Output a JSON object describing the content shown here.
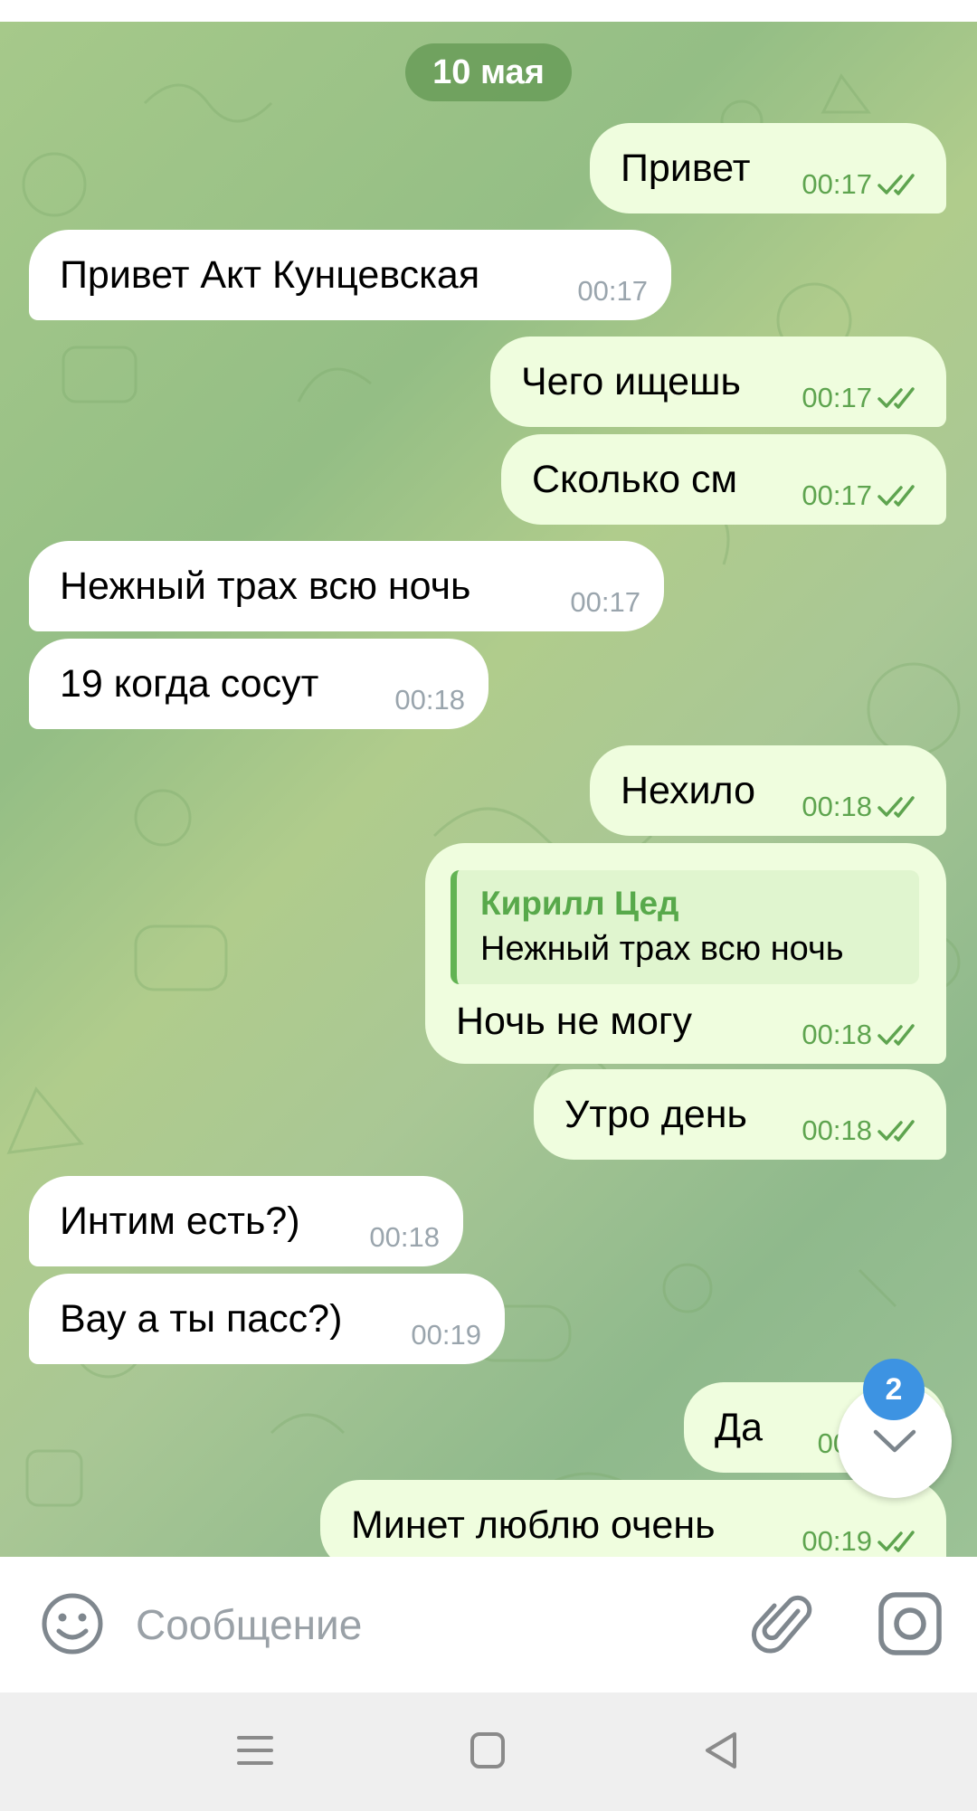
{
  "date_pill": "10 мая",
  "messages": [
    {
      "dir": "out",
      "text": "Привет",
      "time": "00:17",
      "read": true
    },
    {
      "dir": "in",
      "text": "Привет Акт Кунцевская",
      "time": "00:17"
    },
    {
      "dir": "out",
      "text": "Чего ищешь",
      "time": "00:17",
      "read": true
    },
    {
      "dir": "out",
      "text": "Сколько см",
      "time": "00:17",
      "read": true
    },
    {
      "dir": "in",
      "text": "Нежный трах всю ночь",
      "time": "00:17"
    },
    {
      "dir": "in",
      "text": "19 когда сосут",
      "time": "00:18"
    },
    {
      "dir": "out",
      "text": "Нехило",
      "time": "00:18",
      "read": true
    },
    {
      "dir": "out",
      "text": "Ночь не могу",
      "time": "00:18",
      "read": true,
      "reply": {
        "name": "Кирилл Цед",
        "text": "Нежный трах всю ночь"
      }
    },
    {
      "dir": "out",
      "text": "Утро день",
      "time": "00:18",
      "read": true
    },
    {
      "dir": "in",
      "text": "Интим есть?)",
      "time": "00:18"
    },
    {
      "dir": "in",
      "text": "Вау а ты пасс?)",
      "time": "00:19"
    },
    {
      "dir": "out",
      "text": "Да",
      "time": "00:1",
      "read": true
    },
    {
      "dir": "out",
      "text": "Минет люблю очень",
      "time": "00:19",
      "read": true
    }
  ],
  "unread_badge": "2",
  "composer": {
    "placeholder": "Сообщение"
  },
  "icons": {
    "emoji": "emoji-icon",
    "attach": "paperclip-icon",
    "camera": "camera-icon",
    "scroll": "chevron-down-icon",
    "read": "double-check-icon"
  },
  "colors": {
    "outgoing_bubble": "#effdde",
    "incoming_bubble": "#ffffff",
    "accent_green": "#5ea44f",
    "badge_blue": "#3d93e2"
  }
}
